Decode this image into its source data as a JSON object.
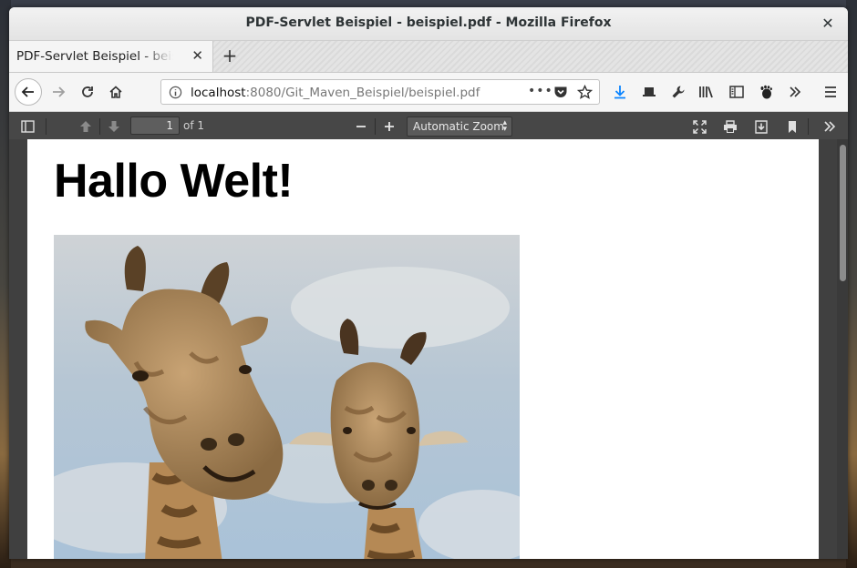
{
  "window": {
    "title": "PDF-Servlet Beispiel - beispiel.pdf - Mozilla Firefox"
  },
  "tabs": [
    {
      "label": "PDF-Servlet Beispiel - beispiel.pdf"
    }
  ],
  "url": {
    "host": "localhost",
    "rest": ":8080/Git_Maven_Beispiel/beispiel.pdf"
  },
  "pdf_toolbar": {
    "page_number": "1",
    "page_count": "of 1",
    "zoom": "Automatic Zoom"
  },
  "document": {
    "heading": "Hallo Welt!"
  },
  "colors": {
    "download_accent": "#0a84ff",
    "pdf_toolbar_bg": "#474747",
    "viewer_bg": "#404040"
  }
}
